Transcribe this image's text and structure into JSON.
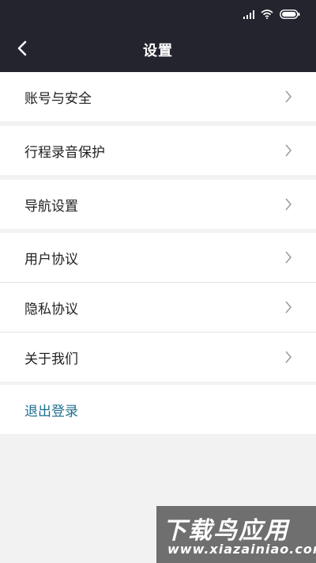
{
  "header": {
    "title": "设置",
    "back_icon": "chevron-left-icon",
    "status_icons": [
      "signal-icon",
      "wifi-icon",
      "battery-icon"
    ],
    "background": "#23242e"
  },
  "settings": {
    "groups": [
      {
        "items": [
          {
            "label": "账号与安全"
          }
        ]
      },
      {
        "items": [
          {
            "label": "行程录音保护"
          }
        ]
      },
      {
        "items": [
          {
            "label": "导航设置"
          }
        ]
      },
      {
        "items": [
          {
            "label": "用户协议"
          },
          {
            "label": "隐私协议"
          },
          {
            "label": "关于我们"
          }
        ]
      }
    ],
    "logout_label": "退出登录",
    "logout_color": "#1f6f8f"
  },
  "watermark": {
    "main": "下载鸟应用",
    "url": "www.xiazainiao.com"
  }
}
